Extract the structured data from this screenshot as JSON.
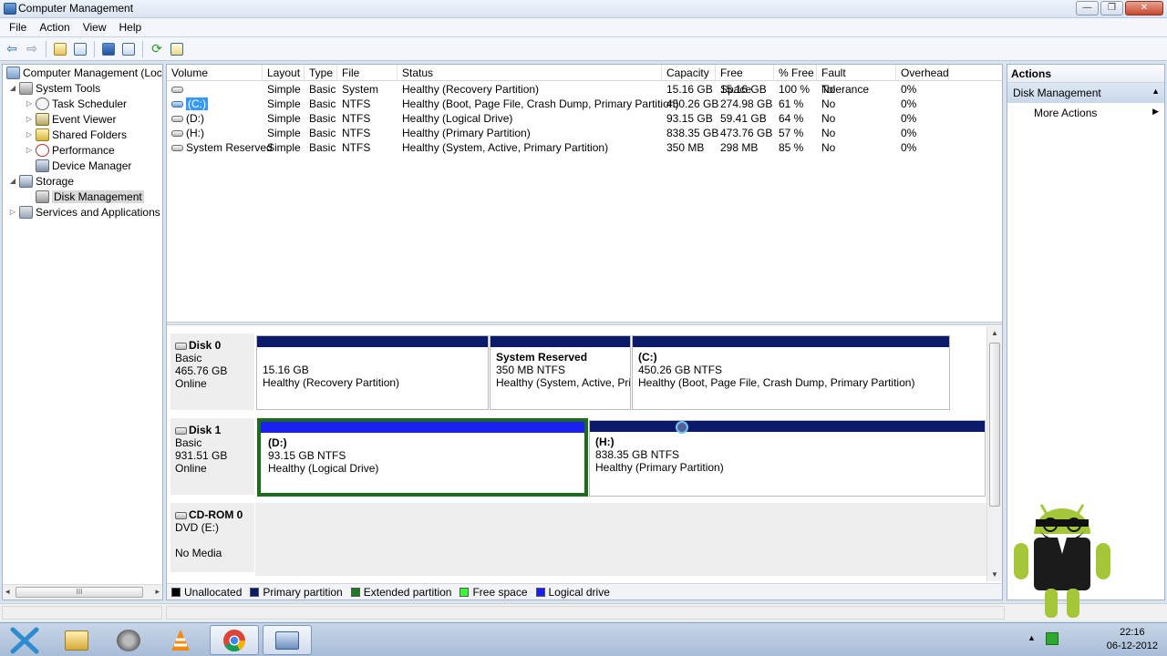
{
  "window": {
    "title": "Computer Management",
    "buttons": {
      "minimize": "—",
      "maximize": "❐",
      "close": "✕"
    }
  },
  "menu": [
    "File",
    "Action",
    "View",
    "Help"
  ],
  "tree": {
    "items": [
      {
        "label": "Computer Management (Local",
        "level": 0,
        "expander": ""
      },
      {
        "label": "System Tools",
        "level": 1,
        "expander": "◢"
      },
      {
        "label": "Task Scheduler",
        "level": 2,
        "expander": "▷"
      },
      {
        "label": "Event Viewer",
        "level": 2,
        "expander": "▷"
      },
      {
        "label": "Shared Folders",
        "level": 2,
        "expander": "▷"
      },
      {
        "label": "Performance",
        "level": 2,
        "expander": "▷"
      },
      {
        "label": "Device Manager",
        "level": 2,
        "expander": ""
      },
      {
        "label": "Storage",
        "level": 1,
        "expander": "◢"
      },
      {
        "label": "Disk Management",
        "level": 2,
        "expander": "",
        "selected": true
      },
      {
        "label": "Services and Applications",
        "level": 1,
        "expander": "▷"
      }
    ],
    "scroll_label": "III"
  },
  "volumes": {
    "columns": [
      "Volume",
      "Layout",
      "Type",
      "File System",
      "Status",
      "Capacity",
      "Free Space",
      "% Free",
      "Fault Tolerance",
      "Overhead"
    ],
    "rows": [
      [
        "",
        "Simple",
        "Basic",
        "",
        "Healthy (Recovery Partition)",
        "15.16 GB",
        "15.16 GB",
        "100 %",
        "No",
        "0%"
      ],
      [
        "(C:)",
        "Simple",
        "Basic",
        "NTFS",
        "Healthy (Boot, Page File, Crash Dump, Primary Partition)",
        "450.26 GB",
        "274.98 GB",
        "61 %",
        "No",
        "0%"
      ],
      [
        "(D:)",
        "Simple",
        "Basic",
        "NTFS",
        "Healthy (Logical Drive)",
        "93.15 GB",
        "59.41 GB",
        "64 %",
        "No",
        "0%"
      ],
      [
        "(H:)",
        "Simple",
        "Basic",
        "NTFS",
        "Healthy (Primary Partition)",
        "838.35 GB",
        "473.76 GB",
        "57 %",
        "No",
        "0%"
      ],
      [
        "System Reserved",
        "Simple",
        "Basic",
        "NTFS",
        "Healthy (System, Active, Primary Partition)",
        "350 MB",
        "298 MB",
        "85 %",
        "No",
        "0%"
      ]
    ]
  },
  "disks": {
    "disk0": {
      "name": "Disk 0",
      "type": "Basic",
      "size": "465.76 GB",
      "state": "Online",
      "partitions": [
        {
          "name": "",
          "size": "15.16 GB",
          "status": "Healthy (Recovery Partition)"
        },
        {
          "name": "System Reserved",
          "size": "350 MB NTFS",
          "status": "Healthy (System, Active, Prir"
        },
        {
          "name": "(C:)",
          "size": "450.26 GB NTFS",
          "status": "Healthy (Boot, Page File, Crash Dump, Primary Partition)"
        }
      ]
    },
    "disk1": {
      "name": "Disk 1",
      "type": "Basic",
      "size": "931.51 GB",
      "state": "Online",
      "partitions": [
        {
          "name": "(D:)",
          "size": "93.15 GB NTFS",
          "status": "Healthy (Logical Drive)"
        },
        {
          "name": "(H:)",
          "size": "838.35 GB NTFS",
          "status": "Healthy (Primary Partition)"
        }
      ]
    },
    "cdrom0": {
      "name": "CD-ROM 0",
      "type": "DVD (E:)",
      "media": "No Media"
    }
  },
  "legend": [
    {
      "label": "Unallocated",
      "color": "#000000"
    },
    {
      "label": "Primary partition",
      "color": "#0c1a6c"
    },
    {
      "label": "Extended partition",
      "color": "#1e7a1e"
    },
    {
      "label": "Free space",
      "color": "#33ff33"
    },
    {
      "label": "Logical drive",
      "color": "#1a1ff5"
    }
  ],
  "actions": {
    "header": "Actions",
    "section": "Disk Management",
    "item": "More Actions"
  },
  "taskbar": {
    "time": "22:16",
    "date": "06-12-2012"
  }
}
